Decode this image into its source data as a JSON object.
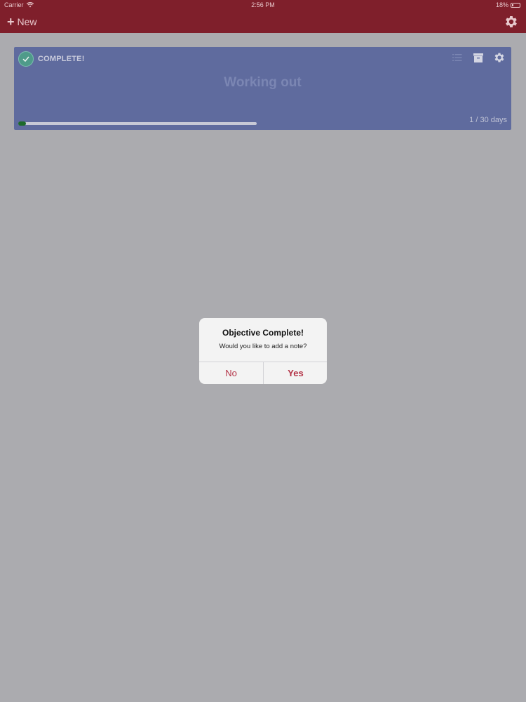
{
  "status_bar": {
    "carrier": "Carrier",
    "time": "2:56 PM",
    "battery": "18%"
  },
  "nav": {
    "new_label": "New",
    "new_icon": "plus-icon",
    "settings_icon": "gear-icon"
  },
  "objective": {
    "status": "COMPLETE!",
    "title": "Working out",
    "days_label": "1 / 30 days",
    "progress": 0.033,
    "icons": [
      "list-icon",
      "archive-icon",
      "gear-icon"
    ]
  },
  "dialog": {
    "title": "Objective Complete!",
    "message": "Would you like to add a note?",
    "no_label": "No",
    "yes_label": "Yes"
  },
  "colors": {
    "brand": "#7f1f2b",
    "card": "#5f6b9e",
    "accent": "#b33246",
    "progress": "#1d6a2c"
  }
}
